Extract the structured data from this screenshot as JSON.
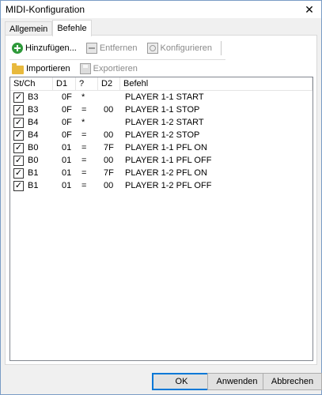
{
  "window": {
    "title": "MIDI-Konfiguration",
    "close_glyph": "✕"
  },
  "tabs": [
    {
      "label": "Allgemein",
      "active": false
    },
    {
      "label": "Befehle",
      "active": true
    }
  ],
  "toolbar": {
    "add_label": "Hinzufügen...",
    "remove_label": "Entfernen",
    "configure_label": "Konfigurieren",
    "import_label": "Importieren",
    "export_label": "Exportieren"
  },
  "columns": [
    "St/Ch",
    "D1",
    "?",
    "D2",
    "Befehl"
  ],
  "rows": [
    {
      "checked": true,
      "stch": "B3",
      "d1": "0F",
      "q": "*",
      "d2": "",
      "befehl": "PLAYER 1-1 START"
    },
    {
      "checked": true,
      "stch": "B3",
      "d1": "0F",
      "q": "=",
      "d2": "00",
      "befehl": "PLAYER 1-1 STOP"
    },
    {
      "checked": true,
      "stch": "B4",
      "d1": "0F",
      "q": "*",
      "d2": "",
      "befehl": "PLAYER 1-2 START"
    },
    {
      "checked": true,
      "stch": "B4",
      "d1": "0F",
      "q": "=",
      "d2": "00",
      "befehl": "PLAYER 1-2 STOP"
    },
    {
      "checked": true,
      "stch": "B0",
      "d1": "01",
      "q": "=",
      "d2": "7F",
      "befehl": "PLAYER 1-1 PFL ON"
    },
    {
      "checked": true,
      "stch": "B0",
      "d1": "01",
      "q": "=",
      "d2": "00",
      "befehl": "PLAYER 1-1 PFL OFF"
    },
    {
      "checked": true,
      "stch": "B1",
      "d1": "01",
      "q": "=",
      "d2": "7F",
      "befehl": "PLAYER 1-2 PFL ON"
    },
    {
      "checked": true,
      "stch": "B1",
      "d1": "01",
      "q": "=",
      "d2": "00",
      "befehl": "PLAYER 1-2 PFL OFF"
    }
  ],
  "footer": {
    "ok_label": "OK",
    "apply_label": "Anwenden",
    "cancel_label": "Abbrechen"
  },
  "icons": {
    "add": "add-icon",
    "remove": "remove-icon",
    "configure": "configure-icon",
    "import": "folder-icon",
    "export": "save-icon"
  },
  "colors": {
    "accent": "#0078d7",
    "add_icon": "#2f9a3b",
    "folder": "#e8b93d"
  }
}
